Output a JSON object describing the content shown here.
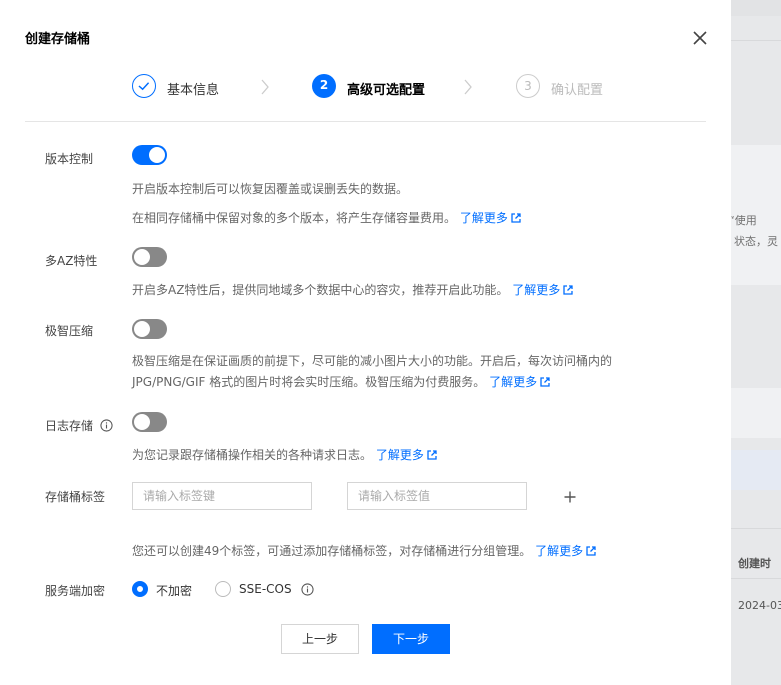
{
  "background": {
    "fragments": [
      "“使用",
      "状态，灵",
      "创建时",
      "2024-03"
    ]
  },
  "dialog": {
    "title": "创建存储桶",
    "steps": [
      {
        "number": "",
        "label": "基本信息",
        "state": "done"
      },
      {
        "number": "2",
        "label": "高级可选配置",
        "state": "active"
      },
      {
        "number": "3",
        "label": "确认配置",
        "state": "pending"
      }
    ],
    "versioning": {
      "label": "版本控制",
      "enabled": true,
      "desc1": "开启版本控制后可以恢复因覆盖或误删丢失的数据。",
      "desc2": "在相同存储桶中保留对象的多个版本，将产生存储容量费用。",
      "link": "了解更多"
    },
    "multi_az": {
      "label": "多AZ特性",
      "enabled": false,
      "desc": "开启多AZ特性后，提供同地域多个数据中心的容灾，推荐开启此功能。",
      "link": "了解更多"
    },
    "compression": {
      "label": "极智压缩",
      "enabled": false,
      "desc1": "极智压缩是在保证画质的前提下，尽可能的减小图片大小的功能。开启后，每次访问桶内的",
      "desc2": "JPG/PNG/GIF 格式的图片时将会实时压缩。极智压缩为付费服务。",
      "link": "了解更多"
    },
    "logging": {
      "label": "日志存储",
      "enabled": false,
      "desc": "为您记录跟存储桶操作相关的各种请求日志。",
      "link": "了解更多"
    },
    "tags": {
      "label": "存储桶标签",
      "key_placeholder": "请输入标签键",
      "value_placeholder": "请输入标签值",
      "key_value": "",
      "value_value": "",
      "desc": "您还可以创建49个标签，可通过添加存储桶标签，对存储桶进行分组管理。",
      "link": "了解更多"
    },
    "encryption": {
      "label": "服务端加密",
      "options": [
        "不加密",
        "SSE-COS"
      ],
      "selected": "不加密"
    },
    "buttons": {
      "prev": "上一步",
      "next": "下一步"
    }
  },
  "colors": {
    "accent": "#006eff",
    "toggle_off": "#888888",
    "muted_text": "#666666",
    "pending_step": "#bbbbbb"
  }
}
